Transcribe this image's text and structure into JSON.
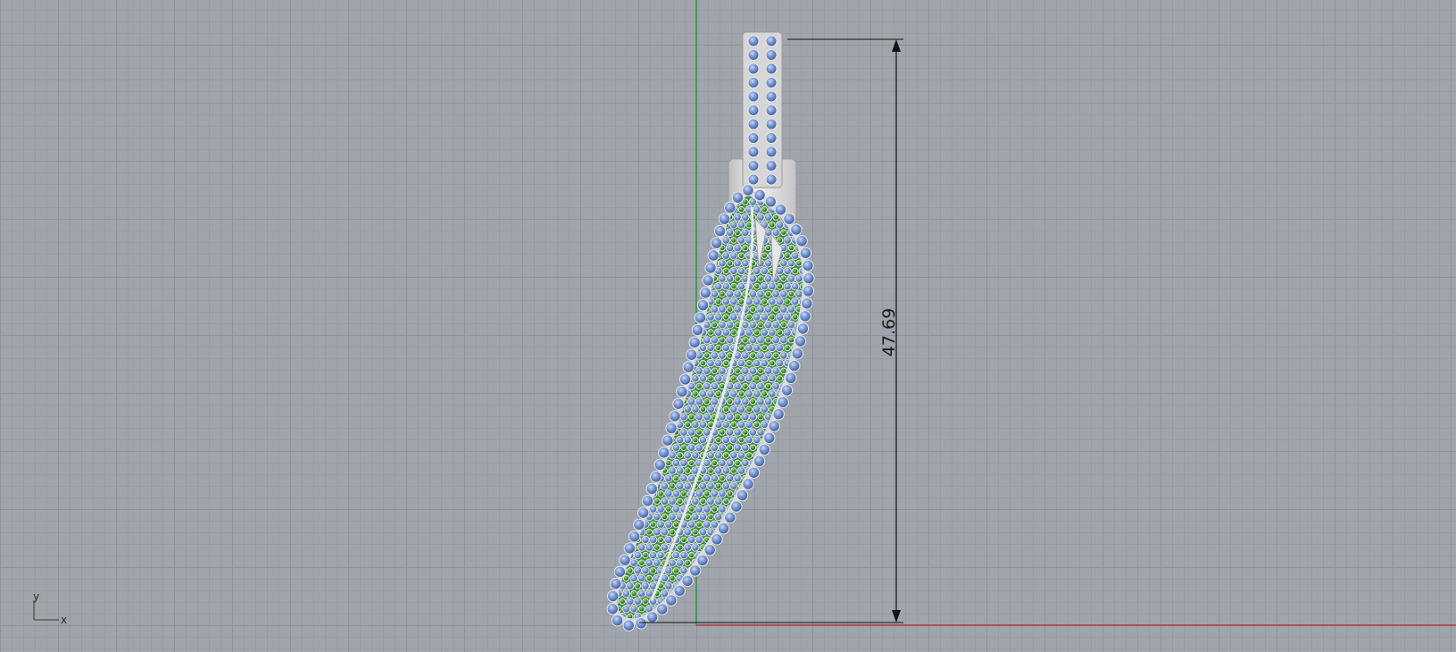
{
  "viewport": {
    "dimension": {
      "value": "47.69"
    },
    "axis_icon": {
      "x_label": "x",
      "y_label": "y"
    }
  },
  "colors": {
    "background": "#9fa5ab",
    "grid_major": "#8d9399",
    "grid_minor": "#979da3",
    "x_axis": "#b03a48",
    "y_axis": "#2e9a3c",
    "metal": "#d8d8d8",
    "blue_stone": "#6f8fd0",
    "green_stone": "#2f7a2c",
    "dimension_line": "#111111"
  },
  "model": {
    "name_icon": "feather-pendant-icon"
  }
}
